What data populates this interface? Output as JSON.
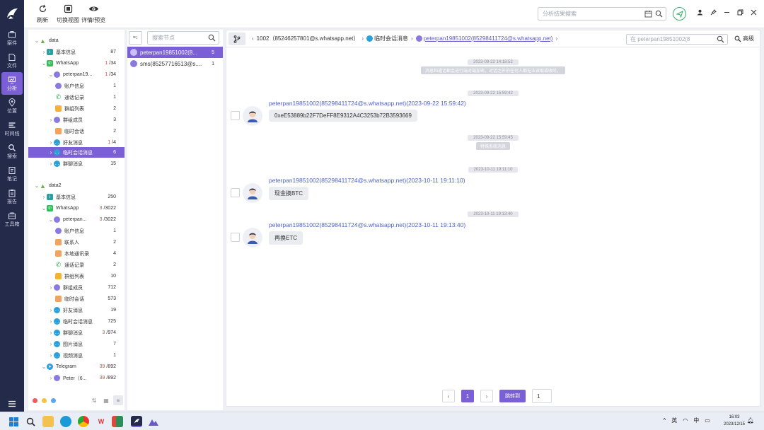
{
  "rail": {
    "items": [
      {
        "label": "案件",
        "icon": "case-icon"
      },
      {
        "label": "文件",
        "icon": "file-icon"
      },
      {
        "label": "分析",
        "icon": "analysis-icon",
        "active": true
      },
      {
        "label": "位置",
        "icon": "location-icon"
      },
      {
        "label": "时间线",
        "icon": "timeline-icon"
      },
      {
        "label": "搜索",
        "icon": "search-icon"
      },
      {
        "label": "笔记",
        "icon": "note-icon"
      },
      {
        "label": "报告",
        "icon": "report-icon"
      },
      {
        "label": "工具箱",
        "icon": "toolbox-icon"
      }
    ]
  },
  "toolbar": {
    "refresh_label": "刷新",
    "switch_view_label": "切换视图",
    "detail_label": "详情/预览",
    "search_placeholder": "分析结果搜索"
  },
  "tree": {
    "data1": {
      "label": "data",
      "basic_info": {
        "label": "基本信息",
        "count": "87"
      },
      "whatsapp": {
        "label": "WhatsApp",
        "red": "1",
        "total": "/34"
      },
      "account": {
        "label": "peterpan19...",
        "red": "1",
        "total": "/34"
      },
      "children": [
        {
          "label": "账户信息",
          "count": "1"
        },
        {
          "label": "通话记录",
          "count": "1"
        },
        {
          "label": "群组列表",
          "count": "2"
        },
        {
          "label": "群组成员",
          "count": "3"
        },
        {
          "label": "临时会话",
          "count": "2"
        },
        {
          "label": "好友消息",
          "red": "1",
          "count": "/4"
        },
        {
          "label": "临时会话消息",
          "count": "6"
        },
        {
          "label": "群聊消息",
          "count": "15"
        }
      ]
    },
    "data2": {
      "label": "data2",
      "basic_info": {
        "label": "基本信息",
        "count": "250"
      },
      "whatsapp": {
        "label": "WhatsApp",
        "red": "3",
        "total": "/3022"
      },
      "account": {
        "label": "peterpan...",
        "red": "3",
        "total": "/3022"
      },
      "children": [
        {
          "label": "账户信息",
          "count": "1"
        },
        {
          "label": "联系人",
          "count": "2"
        },
        {
          "label": "本地通讯录",
          "count": "4"
        },
        {
          "label": "通话记录",
          "count": "2"
        },
        {
          "label": "群组列表",
          "count": "10"
        },
        {
          "label": "群组成员",
          "count": "712"
        },
        {
          "label": "临时会话",
          "count": "573"
        },
        {
          "label": "好友消息",
          "count": "19"
        },
        {
          "label": "临时会话消息",
          "count": "725"
        },
        {
          "label": "群聊消息",
          "red": "3",
          "count": "/974"
        },
        {
          "label": "图片消息",
          "count": "7"
        },
        {
          "label": "视频消息",
          "count": "1"
        }
      ],
      "telegram": {
        "label": "Telegram",
        "red": "39",
        "total": "/892"
      },
      "telegram_account": {
        "label": "Peter（6...",
        "red": "39",
        "total": "/892"
      }
    }
  },
  "nodes": {
    "search_placeholder": "搜索节点",
    "items": [
      {
        "label": "peterpan19851002(8...",
        "count": "5"
      },
      {
        "label": "sms(85257716513@s....",
        "count": "1"
      }
    ]
  },
  "chat": {
    "crumbs": {
      "c1": "1002（85246257801@s.whatsapp.net）",
      "c2": "临时会话消息",
      "c3": "peterpan19851002(85298411724@s.whatsapp.net)"
    },
    "search_placeholder": "在 peterpan19851002(8",
    "advanced_label": "高级",
    "events": {
      "ts1": "2023-09-22 14:18:52",
      "sys1": "消息和通话都会进行端对端加密。对话之外的任何人都无法读取或收听。",
      "ts2": "2023-09-22 15:59:42",
      "m1_sender": "peterpan19851002(85298411724@s.whatsapp.net)(2023-09-22 15:59:42)",
      "m1_text": "0xeE53889b22F7DeFF8E9312A4C3253b72B3593669",
      "ts3": "2023-09-22 15:59:45",
      "sys2": "特殊系统消息",
      "ts4": "2023-10-11 19:11:10",
      "m2_sender": "peterpan19851002(85298411724@s.whatsapp.net)(2023-10-11 19:11:10)",
      "m2_text": "现金换BTC",
      "ts5": "2023-10-11 19:13:40",
      "m3_sender": "peterpan19851002(85298411724@s.whatsapp.net)(2023-10-11 19:13:40)",
      "m3_text": "再换ETC"
    },
    "pager": {
      "current": "1",
      "jump_label": "跳转到",
      "jump_value": "1"
    }
  },
  "taskbar": {
    "tray_lang": "英",
    "tray_ime": "中",
    "time": "16:03",
    "date": "2023/12/15"
  },
  "colors": {
    "accent": "#7b5fd6",
    "rail": "#242a4a",
    "sender": "#4b62c7",
    "whatsapp": "#2fbf5a",
    "telegram": "#2aa0da",
    "count_red": "#e04a4a"
  }
}
